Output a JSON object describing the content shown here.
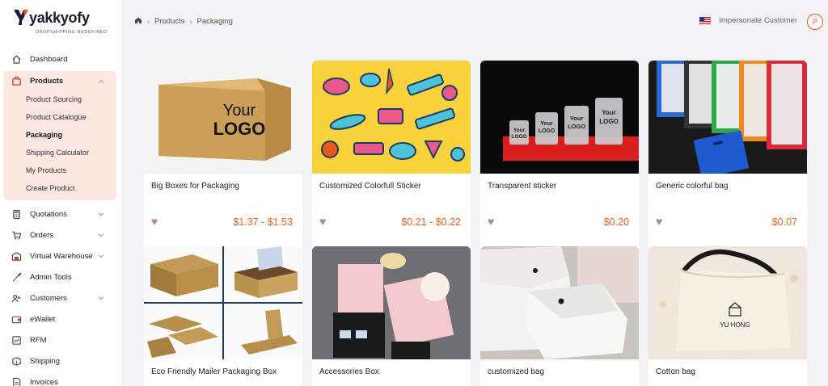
{
  "brand": {
    "name": "yakkyofy",
    "tagline": "DROPSHIPPING REDEFINED",
    "accent": "#e85a1c"
  },
  "sidebar": {
    "items_before": [
      {
        "label": "Dashboard",
        "icon": "home-icon"
      }
    ],
    "products": {
      "label": "Products",
      "icon": "bag-icon",
      "sub": [
        {
          "label": "Product Sourcing",
          "active": false
        },
        {
          "label": "Product Catalogue",
          "active": false
        },
        {
          "label": "Packaging",
          "active": true
        },
        {
          "label": "Shipping Calculator",
          "active": false
        },
        {
          "label": "My Products",
          "active": false
        },
        {
          "label": "Create Product",
          "active": false
        }
      ]
    },
    "items_after": [
      {
        "label": "Quotations",
        "icon": "calculator-icon",
        "chevron": true
      },
      {
        "label": "Orders",
        "icon": "orders-icon",
        "chevron": true
      },
      {
        "label": "Virtual Warehouse",
        "icon": "warehouse-icon",
        "chevron": true
      },
      {
        "label": "Admin Tools",
        "icon": "rocket-icon",
        "chevron": false
      },
      {
        "label": "Customers",
        "icon": "customers-icon",
        "chevron": true
      },
      {
        "label": "eWallet",
        "icon": "wallet-icon",
        "chevron": false
      },
      {
        "label": "RFM",
        "icon": "rfm-icon",
        "chevron": false
      },
      {
        "label": "Shipping",
        "icon": "shipping-icon",
        "chevron": false
      },
      {
        "label": "Invoices",
        "icon": "invoices-icon",
        "chevron": false
      }
    ]
  },
  "header": {
    "breadcrumb": [
      "Products",
      "Packaging"
    ],
    "impersonate": "Impersonate Customer",
    "avatar": "P"
  },
  "prev_row": [],
  "products_row1": [
    {
      "title": "Big Boxes for Packaging",
      "price": "$1.37 - $1.53",
      "image": "kraft-box-your-logo"
    },
    {
      "title": "Customized Colorfull Sticker",
      "price": "$0.21 - $0.22",
      "image": "colorful-stickers"
    },
    {
      "title": "Transparent sticker",
      "price": "$0.20",
      "image": "transparent-stickers"
    },
    {
      "title": "Generic colorful bag",
      "price": "$0.07",
      "image": "colorful-zip-bags"
    }
  ],
  "products_row2": [
    {
      "title": "Eco Friendly Mailer Packaging Box",
      "image": "mailer-boxes"
    },
    {
      "title": "Accessories Box",
      "image": "pink-accessory-box"
    },
    {
      "title": "customized bag",
      "image": "white-envelope-bag"
    },
    {
      "title": "Cotton bag",
      "image": "cotton-drawstring-bag"
    }
  ]
}
